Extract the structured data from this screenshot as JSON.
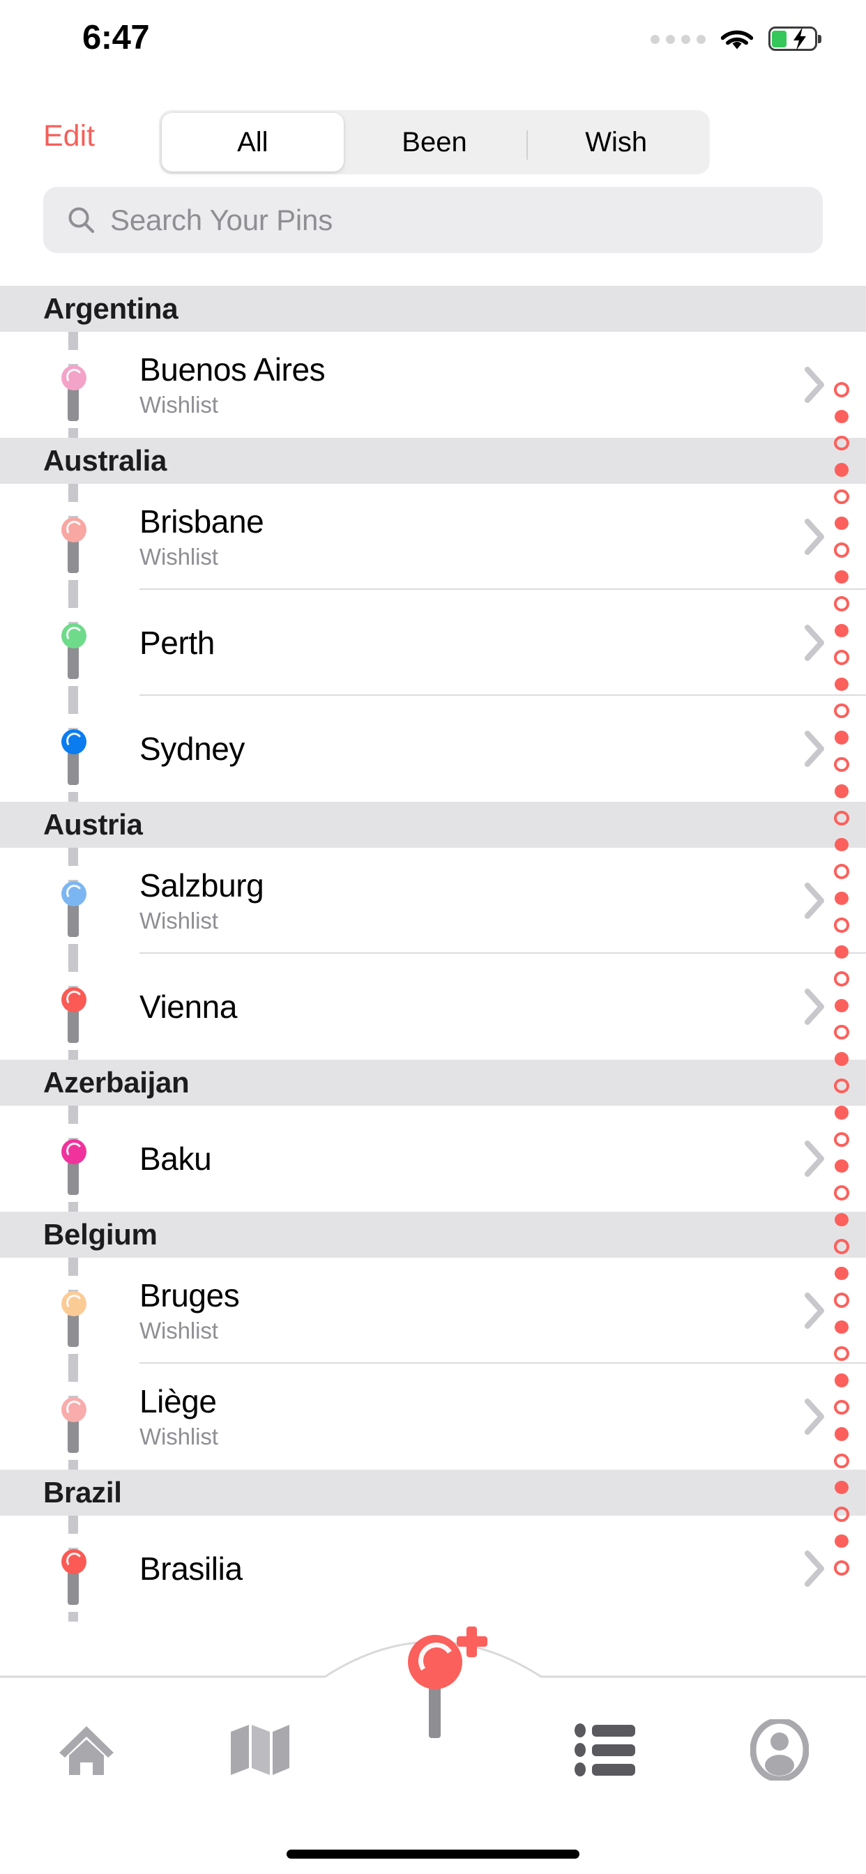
{
  "status_bar": {
    "time": "6:47",
    "signal_icon": "signal-dots-icon",
    "wifi_icon": "wifi-icon",
    "battery_icon": "battery-charging-icon",
    "battery_level_percent": 32,
    "battery_charging": true
  },
  "top_bar": {
    "edit_label": "Edit",
    "segments": [
      {
        "label": "All",
        "selected": true
      },
      {
        "label": "Been",
        "selected": false
      },
      {
        "label": "Wish",
        "selected": false
      }
    ]
  },
  "search": {
    "placeholder": "Search Your Pins",
    "value": "",
    "icon": "search-icon"
  },
  "colors": {
    "accent_red": "#fb605c",
    "edit_red": "#f4605b",
    "section_header_bg": "#e3e3e5",
    "subtitle_gray": "#8e8e93",
    "separator": "#dcdce0"
  },
  "list": {
    "sections": [
      {
        "title": "Argentina",
        "rows": [
          {
            "title": "Buenos Aires",
            "subtitle": "Wishlist",
            "pin_color": "#f4a3c8",
            "chevron": "chevron-right-icon"
          }
        ]
      },
      {
        "title": "Australia",
        "rows": [
          {
            "title": "Brisbane",
            "subtitle": "Wishlist",
            "pin_color": "#f8a7a3",
            "chevron": "chevron-right-icon"
          },
          {
            "title": "Perth",
            "subtitle": "",
            "pin_color": "#6edb8a",
            "chevron": "chevron-right-icon"
          },
          {
            "title": "Sydney",
            "subtitle": "",
            "pin_color": "#0a7cf0",
            "chevron": "chevron-right-icon"
          }
        ]
      },
      {
        "title": "Austria",
        "rows": [
          {
            "title": "Salzburg",
            "subtitle": "Wishlist",
            "pin_color": "#7cb6f2",
            "chevron": "chevron-right-icon"
          },
          {
            "title": "Vienna",
            "subtitle": "",
            "pin_color": "#fb5a55",
            "chevron": "chevron-right-icon"
          }
        ]
      },
      {
        "title": "Azerbaijan",
        "rows": [
          {
            "title": "Baku",
            "subtitle": "",
            "pin_color": "#f0339c",
            "chevron": "chevron-right-icon"
          }
        ]
      },
      {
        "title": "Belgium",
        "rows": [
          {
            "title": "Bruges",
            "subtitle": "Wishlist",
            "pin_color": "#fbcb96",
            "chevron": "chevron-right-icon"
          },
          {
            "title": "Liège",
            "subtitle": "Wishlist",
            "pin_color": "#f9acac",
            "chevron": "chevron-right-icon"
          }
        ]
      },
      {
        "title": "Brazil",
        "rows": [
          {
            "title": "Brasilia",
            "subtitle": "",
            "pin_color": "#fb5a55",
            "chevron": "chevron-right-icon"
          }
        ]
      }
    ]
  },
  "index_strip": {
    "marker_color": "#fc605c",
    "pattern": [
      "ring",
      "filled",
      "ring",
      "filled",
      "ring",
      "filled",
      "ring",
      "filled",
      "ring",
      "filled",
      "ring",
      "filled",
      "ring",
      "filled",
      "ring",
      "filled",
      "ring",
      "filled",
      "ring",
      "filled",
      "ring",
      "filled",
      "ring",
      "filled",
      "ring",
      "filled",
      "ring",
      "filled",
      "ring",
      "filled",
      "ring",
      "filled",
      "ring",
      "filled",
      "ring",
      "filled",
      "ring",
      "filled",
      "ring",
      "filled",
      "ring",
      "filled",
      "ring",
      "filled",
      "ring"
    ]
  },
  "tab_bar": {
    "items": [
      {
        "name": "home",
        "icon": "home-icon",
        "active": false
      },
      {
        "name": "map",
        "icon": "map-icon",
        "active": false
      },
      {
        "name": "add-pin",
        "icon": "pin-plus-icon",
        "active": false
      },
      {
        "name": "list",
        "icon": "list-icon",
        "active": false
      },
      {
        "name": "profile",
        "icon": "person-circle-icon",
        "active": false
      }
    ]
  }
}
